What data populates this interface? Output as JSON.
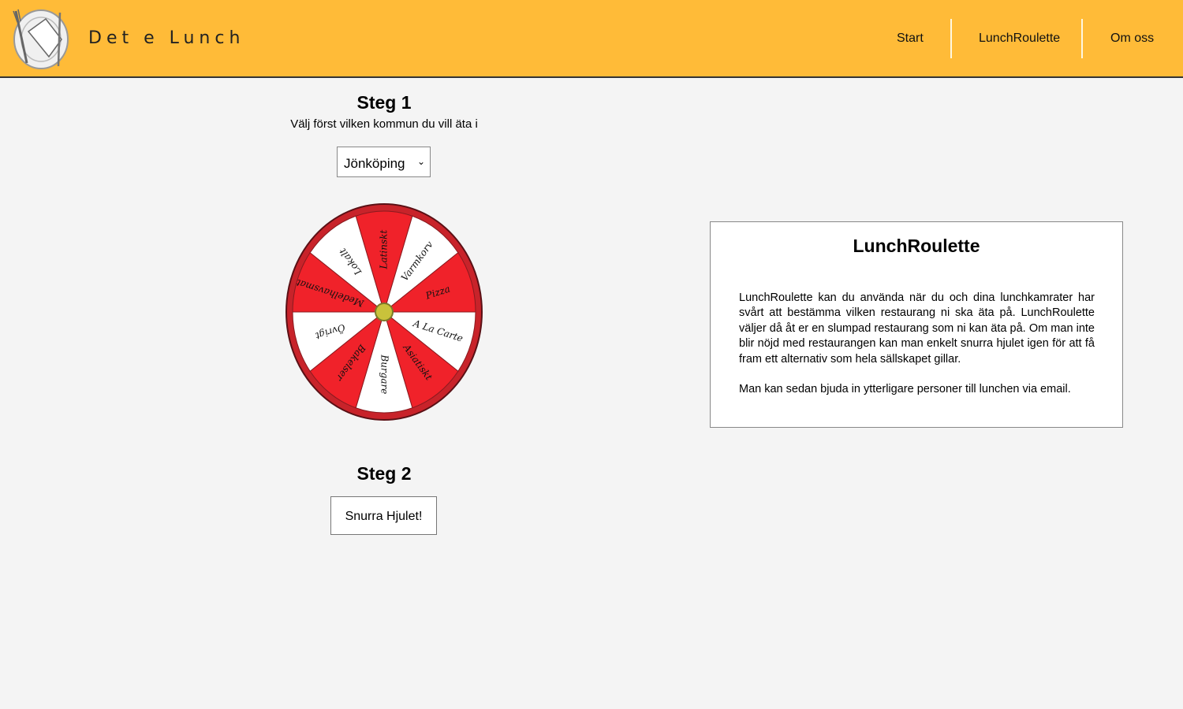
{
  "header": {
    "brand": "Det e Lunch",
    "nav": [
      "Start",
      "LunchRoulette",
      "Om oss"
    ]
  },
  "step1": {
    "title": "Steg 1",
    "subtitle": "Välj först vilken kommun du vill äta i",
    "selected_municipality": "Jönköping"
  },
  "wheel": {
    "segments": [
      "Latinskt",
      "Varmkorv",
      "Pizza",
      "A La Carte",
      "Asiatiskt",
      "Burgare",
      "Bakelser",
      "Övrigt",
      "Medelhavsmat",
      "Lokalt"
    ],
    "colors": {
      "red": "#f0222a",
      "white": "#ffffff",
      "rim": "#c8232a",
      "hub": "#c9c23b"
    }
  },
  "step2": {
    "title": "Steg 2",
    "button_label": "Snurra Hjulet!"
  },
  "info": {
    "title": "LunchRoulette",
    "paragraph1": "LunchRoulette kan du använda när du och dina lunchkamrater har svårt att bestämma vilken restaurang ni ska äta på. LunchRoulette väljer då åt er en slumpad restaurang som ni kan äta på. Om man inte blir nöjd med restaurangen kan man enkelt snurra hjulet igen för att få fram ett alternativ som hela sällskapet gillar.",
    "paragraph2": "Man kan sedan bjuda in ytterligare personer till lunchen via email."
  },
  "accent_color": "#ffbb38"
}
